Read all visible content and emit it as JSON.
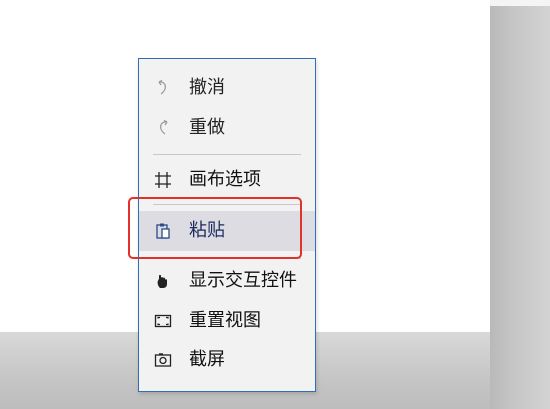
{
  "context_menu": {
    "items": [
      {
        "label": "撤消",
        "icon": "undo-icon",
        "enabled": false
      },
      {
        "label": "重做",
        "icon": "redo-icon",
        "enabled": false
      },
      {
        "label": "画布选项",
        "icon": "canvas-options-icon",
        "enabled": true
      },
      {
        "label": "粘贴",
        "icon": "paste-icon",
        "enabled": true,
        "highlighted": true
      },
      {
        "label": "显示交互控件",
        "icon": "interaction-widget-icon",
        "enabled": true
      },
      {
        "label": "重置视图",
        "icon": "reset-view-icon",
        "enabled": true
      },
      {
        "label": "截屏",
        "icon": "screenshot-icon",
        "enabled": true
      }
    ]
  },
  "colors": {
    "menu_background": "#f2f2f2",
    "menu_border": "#2f6fb3",
    "hover_background": "#dcdce2",
    "annotation_red": "#e0312b"
  }
}
